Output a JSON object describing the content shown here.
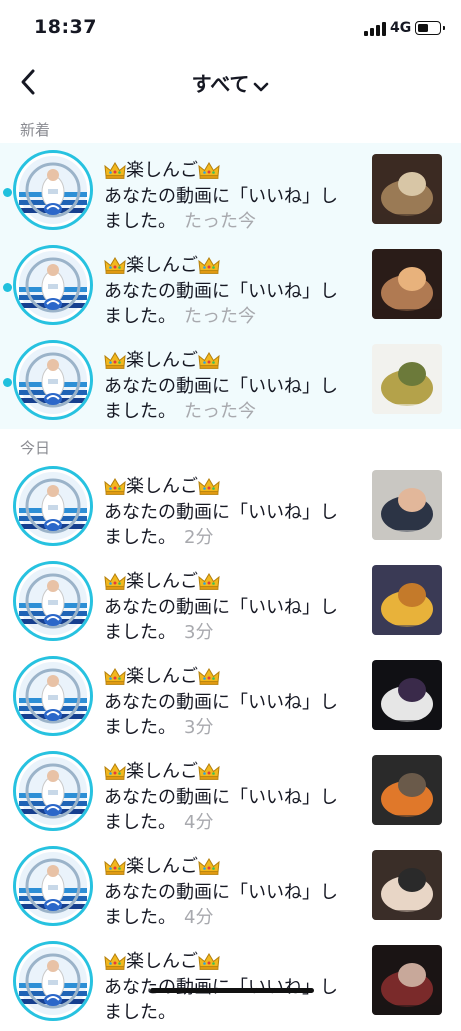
{
  "status_bar": {
    "time": "18:37",
    "network": "4G",
    "battery_level": 0.55
  },
  "nav": {
    "title": "すべて"
  },
  "sections": {
    "new": "新着",
    "today": "今日"
  },
  "notifications": [
    {
      "name": "楽しんご",
      "message": "あなたの動画に「いいね」しました。",
      "time": "たった今",
      "unread": true,
      "thumb_colors": [
        "#3b2a22",
        "#9a7a55",
        "#d8c6a6"
      ]
    },
    {
      "name": "楽しんご",
      "message": "あなたの動画に「いいね」しました。",
      "time": "たった今",
      "unread": true,
      "thumb_colors": [
        "#2a1c18",
        "#b07a52",
        "#e8b27c"
      ]
    },
    {
      "name": "楽しんご",
      "message": "あなたの動画に「いいね」しました。",
      "time": "たった今",
      "unread": true,
      "thumb_colors": [
        "#f2f2ee",
        "#b4a24a",
        "#6c7a3a"
      ]
    },
    {
      "name": "楽しんご",
      "message": "あなたの動画に「いいね」しました。",
      "time": "2分",
      "unread": false,
      "thumb_colors": [
        "#c9c7c2",
        "#2c3445",
        "#e2b79a"
      ]
    },
    {
      "name": "楽しんご",
      "message": "あなたの動画に「いいね」しました。",
      "time": "3分",
      "unread": false,
      "thumb_colors": [
        "#3a3a55",
        "#e8b23a",
        "#c47a2a"
      ]
    },
    {
      "name": "楽しんご",
      "message": "あなたの動画に「いいね」しました。",
      "time": "3分",
      "unread": false,
      "thumb_colors": [
        "#101014",
        "#e6e6e6",
        "#3a2a4a"
      ]
    },
    {
      "name": "楽しんご",
      "message": "あなたの動画に「いいね」しました。",
      "time": "4分",
      "unread": false,
      "thumb_colors": [
        "#2a2a2a",
        "#e0782a",
        "#6a5a4a"
      ]
    },
    {
      "name": "楽しんご",
      "message": "あなたの動画に「いいね」しました。",
      "time": "4分",
      "unread": false,
      "thumb_colors": [
        "#3a2e28",
        "#e8d6c6",
        "#2a2a2a"
      ]
    },
    {
      "name": "楽しんご",
      "message": "あなたの動画に「いいね」しました。",
      "time": "",
      "unread": false,
      "thumb_colors": [
        "#1a1414",
        "#7a2a2a",
        "#c8a89a"
      ]
    }
  ],
  "icons": {
    "back": "chevron-left-icon",
    "dropdown": "chevron-down-icon",
    "crown": "crown-icon"
  },
  "colors": {
    "accent": "#27c2e0",
    "unread_bg": "#f1fbfd",
    "muted": "#a8a9ae"
  }
}
